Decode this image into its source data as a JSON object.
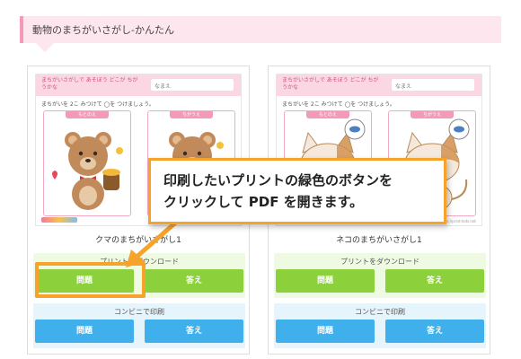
{
  "header": {
    "title": "動物のまちがいさがし-かんたん"
  },
  "cards": [
    {
      "thumb": {
        "title": "まちがいさがしで あそぼう どこが ちがうかな",
        "name_label": "なまえ",
        "instruction": "まちがいを 2こ みつけて ◯を つけましょう。",
        "pane_left": "もとのえ",
        "pane_right": "ちがうえ",
        "footer_note": "https://print-kids.net"
      },
      "title": "クマのまちがいさがし1",
      "download_label": "プリントをダウンロード",
      "q_button": "問題",
      "a_button": "答え",
      "convenience_label": "コンビニで印刷",
      "cq_button": "問題",
      "ca_button": "答え"
    },
    {
      "thumb": {
        "title": "まちがいさがしで あそぼう どこが ちがうかな",
        "name_label": "なまえ",
        "instruction": "まちがいを 2こ みつけて ◯を つけましょう。",
        "pane_left": "もとのえ",
        "pane_right": "ちがうえ",
        "footer_note": "https://print-kids.net"
      },
      "title": "ネコのまちがいさがし1",
      "download_label": "プリントをダウンロード",
      "q_button": "問題",
      "a_button": "答え",
      "convenience_label": "コンビニで印刷",
      "cq_button": "問題",
      "ca_button": "答え"
    }
  ],
  "callout": {
    "line1": "印刷したいプリントの緑色のボタンを",
    "line2": "クリックして PDF を開きます。"
  },
  "colors": {
    "accent_orange": "#f5a32b",
    "green_button": "#8cd13c",
    "blue_button": "#3fb0ec",
    "banner_pink": "#fde6ee"
  }
}
